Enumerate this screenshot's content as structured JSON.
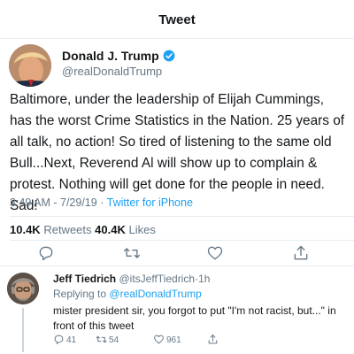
{
  "header": {
    "title": "Tweet"
  },
  "tweet": {
    "author_name": "Donald J. Trump",
    "author_handle": "@realDonaldTrump",
    "text": "Baltimore, under the leadership of Elijah Cummings, has the worst Crime Statistics in the Nation. 25 years of all talk, no action! So tired of listening to the same old Bull...Next, Reverend Al will show up to complain & protest. Nothing will get done for the people in need. Sad!",
    "time": "3:49 AM",
    "date": "7/29/19",
    "separator": "·",
    "source": "Twitter for iPhone",
    "retweets_count": "10.4K",
    "retweets_label": "Retweets",
    "likes_count": "40.4K",
    "likes_label": "Likes"
  },
  "reply": {
    "author_name": "Jeff Tiedrich",
    "author_handle": "@itsJeffTiedrich",
    "separator": "·",
    "age": "1h",
    "replying_label": "Replying to",
    "replying_to": "@realDonaldTrump",
    "text": "mister president sir, you forgot to put \"I'm not racist, but...\" in front of this tweet",
    "reply_count": "41",
    "retweet_count": "54",
    "like_count": "961"
  },
  "icons": {
    "verified": "verified-badge-icon",
    "reply": "reply-icon",
    "retweet": "retweet-icon",
    "like": "heart-icon",
    "share": "share-icon"
  },
  "colors": {
    "accent": "#1da1f2",
    "secondary_text": "#657786",
    "divider": "#e6ecf0"
  }
}
